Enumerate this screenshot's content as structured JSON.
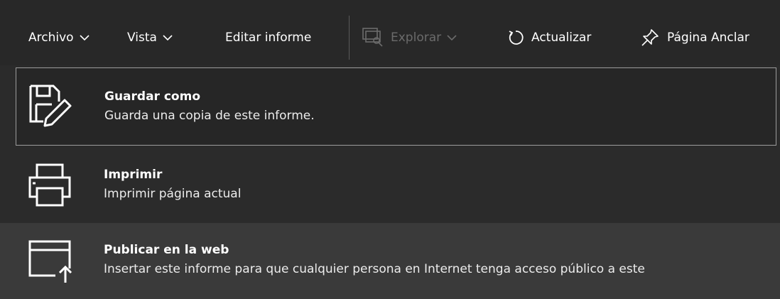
{
  "toolbar": {
    "archivo": "Archivo",
    "vista": "Vista",
    "editar": "Editar informe",
    "explorar": "Explorar",
    "actualizar": "Actualizar",
    "anclar": "Página Anclar"
  },
  "menu": {
    "items": [
      {
        "title": "Guardar como",
        "desc": "Guarda una copia de este informe.",
        "icon": "save-as-icon",
        "state": "focused"
      },
      {
        "title": "Imprimir",
        "desc": "Imprimir página actual",
        "icon": "printer-icon",
        "state": "normal"
      },
      {
        "title": "Publicar en la web",
        "desc": "Insertar este informe para que cualquier persona en Internet tenga acceso público a este",
        "icon": "publish-web-icon",
        "state": "hovered"
      }
    ]
  },
  "colors": {
    "toolbar_bg": "#282828",
    "menu_bg": "#2b2b2b",
    "hover_bg": "#3a3a3a",
    "focus_border": "#9c9c9c",
    "disabled_text": "#6b6b6b"
  }
}
